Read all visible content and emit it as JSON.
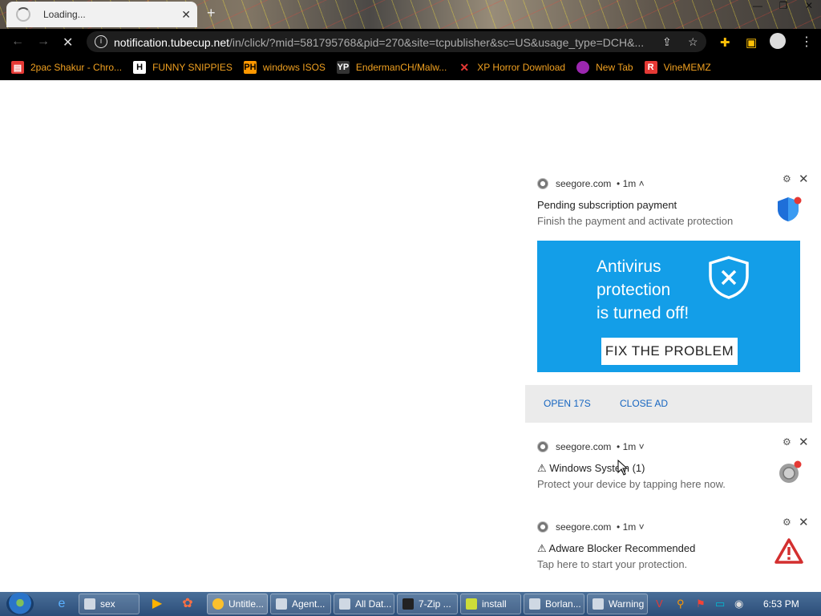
{
  "browser": {
    "tab_title": "Loading...",
    "url_domain": "notification.tubecup.net",
    "url_rest": "/in/click/?mid=581795768&pid=270&site=tcpublisher&sc=US&usage_type=DCH&..."
  },
  "bookmarks": [
    {
      "label": "2pac Shakur - Chro...",
      "icon": "bag-icon",
      "color": "#e53935"
    },
    {
      "label": "FUNNY SNIPPIES",
      "icon": "h-icon",
      "color": "#ffffff"
    },
    {
      "label": "windows ISOS",
      "icon": "ph-icon",
      "color": "#ff9800"
    },
    {
      "label": "EndermanCH/Malw...",
      "icon": "yp-icon",
      "color": "#333333"
    },
    {
      "label": "XP Horror Download",
      "icon": "x-icon",
      "color": "#e53935"
    },
    {
      "label": "New Tab",
      "icon": "globe-icon",
      "color": "#9c27b0"
    },
    {
      "label": "VineMEMZ",
      "icon": "r-icon",
      "color": "#e53935"
    }
  ],
  "notifications": [
    {
      "source": "seegore.com",
      "time": "• 1m",
      "caret": "˄",
      "title": "Pending subscription payment",
      "subtitle": "Finish the payment and activate protection"
    },
    {
      "source": "seegore.com",
      "time": "• 1m",
      "caret": "˅",
      "title": "⚠ Windows System (1)",
      "subtitle": "Protect your device by tapping here now."
    },
    {
      "source": "seegore.com",
      "time": "• 1m",
      "caret": "˅",
      "title": "⚠ Adware Blocker Recommended",
      "subtitle": "Tap here to start your protection."
    }
  ],
  "banner": {
    "line1": "Antivirus",
    "line2": "protection",
    "line3": "is turned off!",
    "button": "FIX THE PROBLEM",
    "color": "#139ee8"
  },
  "actions": {
    "open": "OPEN 17S",
    "close": "CLOSE AD"
  },
  "taskbar": {
    "buttons": [
      "sex",
      "Untitle...",
      "Agent...",
      "All Dat...",
      "7-Zip ...",
      "install",
      "Borlan...",
      "Warning"
    ],
    "clock": "6:53 PM"
  }
}
